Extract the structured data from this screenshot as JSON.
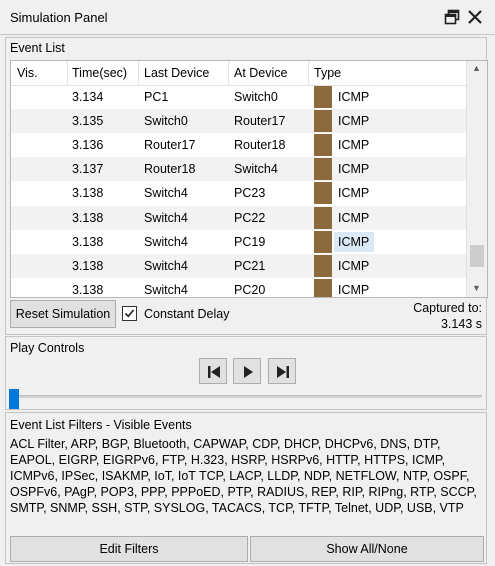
{
  "window": {
    "title": "Simulation Panel"
  },
  "event_list": {
    "label": "Event List",
    "columns": [
      "Vis.",
      "Time(sec)",
      "Last Device",
      "At Device",
      "Type"
    ],
    "rows": [
      {
        "time": "3.134",
        "last": "PC1",
        "at": "Switch0",
        "type": "ICMP"
      },
      {
        "time": "3.135",
        "last": "Switch0",
        "at": "Router17",
        "type": "ICMP"
      },
      {
        "time": "3.136",
        "last": "Router17",
        "at": "Router18",
        "type": "ICMP"
      },
      {
        "time": "3.137",
        "last": "Router18",
        "at": "Switch4",
        "type": "ICMP"
      },
      {
        "time": "3.138",
        "last": "Switch4",
        "at": "PC23",
        "type": "ICMP"
      },
      {
        "time": "3.138",
        "last": "Switch4",
        "at": "PC22",
        "type": "ICMP"
      },
      {
        "time": "3.138",
        "last": "Switch4",
        "at": "PC19",
        "type": "ICMP"
      },
      {
        "time": "3.138",
        "last": "Switch4",
        "at": "PC21",
        "type": "ICMP"
      },
      {
        "time": "3.138",
        "last": "Switch4",
        "at": "PC20",
        "type": "ICMP"
      }
    ],
    "type_color": "#8b6a3e",
    "reset_label": "Reset Simulation",
    "constant_delay_label": "Constant Delay",
    "constant_delay_checked": true,
    "captured_label": "Captured to:",
    "captured_value": "3.143 s"
  },
  "play_controls": {
    "label": "Play Controls",
    "buttons": [
      "back-icon",
      "play-icon",
      "forward-icon"
    ]
  },
  "filters": {
    "label": "Event List Filters - Visible Events",
    "protocols": "ACL Filter, ARP, BGP, Bluetooth, CAPWAP, CDP, DHCP, DHCPv6, DNS, DTP, EAPOL, EIGRP, EIGRPv6, FTP, H.323, HSRP, HSRPv6, HTTP, HTTPS, ICMP, ICMPv6, IPSec, ISAKMP, IoT, IoT TCP, LACP, LLDP, NDP, NETFLOW, NTP, OSPF, OSPFv6, PAgP, POP3, PPP, PPPoED, PTP, RADIUS, REP, RIP, RIPng, RTP, SCCP, SMTP, SNMP, SSH, STP, SYSLOG, TACACS, TCP, TFTP, Telnet, UDP, USB, VTP",
    "edit_label": "Edit Filters",
    "show_all_label": "Show All/None"
  }
}
